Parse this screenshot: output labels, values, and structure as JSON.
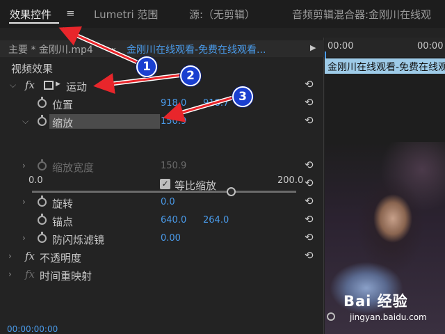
{
  "tabs": {
    "effect_controls": "效果控件",
    "menu": "≡",
    "lumetri": "Lumetri 范围",
    "source": "源:（无剪辑）",
    "audio_mixer": "音频剪辑混合器:金刚川在线观"
  },
  "clip_bar": {
    "main_clip": "主要 * 金刚川.mp4",
    "chevron": "⌄",
    "sequence": "金刚川在线观看-免费在线观看...",
    "play_mark": "▶"
  },
  "section": {
    "video_effects": "视频效果"
  },
  "motion": {
    "fx": "fx",
    "label": "运动"
  },
  "position": {
    "label": "位置",
    "x": "918.0",
    "y": "918.7"
  },
  "scale": {
    "label": "缩放",
    "value": "150.9",
    "slider_min": "0.0",
    "slider_max": "200.0",
    "slider_fraction": 0.754
  },
  "scale_width": {
    "label": "缩放宽度",
    "value": "150.9"
  },
  "uniform_scale": {
    "label": "等比缩放",
    "checked": true
  },
  "rotation": {
    "label": "旋转",
    "value": "0.0"
  },
  "anchor": {
    "label": "锚点",
    "x": "640.0",
    "y": "264.0"
  },
  "anti_flicker": {
    "label": "防闪烁滤镜",
    "value": "0.00"
  },
  "opacity": {
    "fx": "fx",
    "label": "不透明度"
  },
  "time_remap": {
    "fx": "fx",
    "label": "时间重映射"
  },
  "timecode": "00:00:00:00",
  "timeline": {
    "ruler_left": "00:00",
    "ruler_right": "00:00",
    "clip_label": "金刚川在线观看-免费在线观看"
  },
  "watermark": {
    "brand": "Bai 经验",
    "url": "jingyan.baidu.com"
  },
  "annotations": {
    "one": "1",
    "two": "2",
    "three": "3"
  },
  "colors": {
    "accent_blue": "#4a9bea",
    "annotation_red": "#e8262b",
    "badge_blue": "#1a3fd0"
  },
  "icons": {
    "reset": "reset-icon",
    "stopwatch": "stopwatch-icon",
    "motion_transform": "transform-box-icon"
  }
}
